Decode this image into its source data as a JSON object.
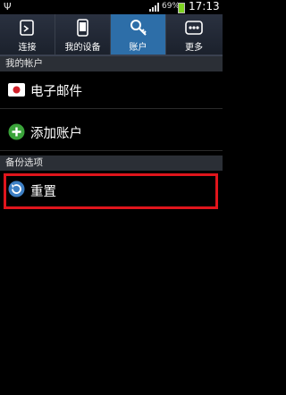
{
  "status": {
    "battery_pct": "69%",
    "time": "17:13",
    "usb_icon": "usb-icon"
  },
  "tabs": [
    {
      "label": "连接",
      "icon": "connections-icon",
      "active": false
    },
    {
      "label": "我的设备",
      "icon": "device-icon",
      "active": false
    },
    {
      "label": "账户",
      "icon": "key-icon",
      "active": true
    },
    {
      "label": "更多",
      "icon": "more-icon",
      "active": false
    }
  ],
  "sections": {
    "my_accounts": "我的帐户",
    "backup": "备份选项"
  },
  "items": {
    "email": "电子邮件",
    "add_account": "添加账户",
    "reset": "重置"
  },
  "colors": {
    "active_tab": "#2d6ea8",
    "highlight": "#e0151c",
    "add_green": "#3aa33a"
  }
}
